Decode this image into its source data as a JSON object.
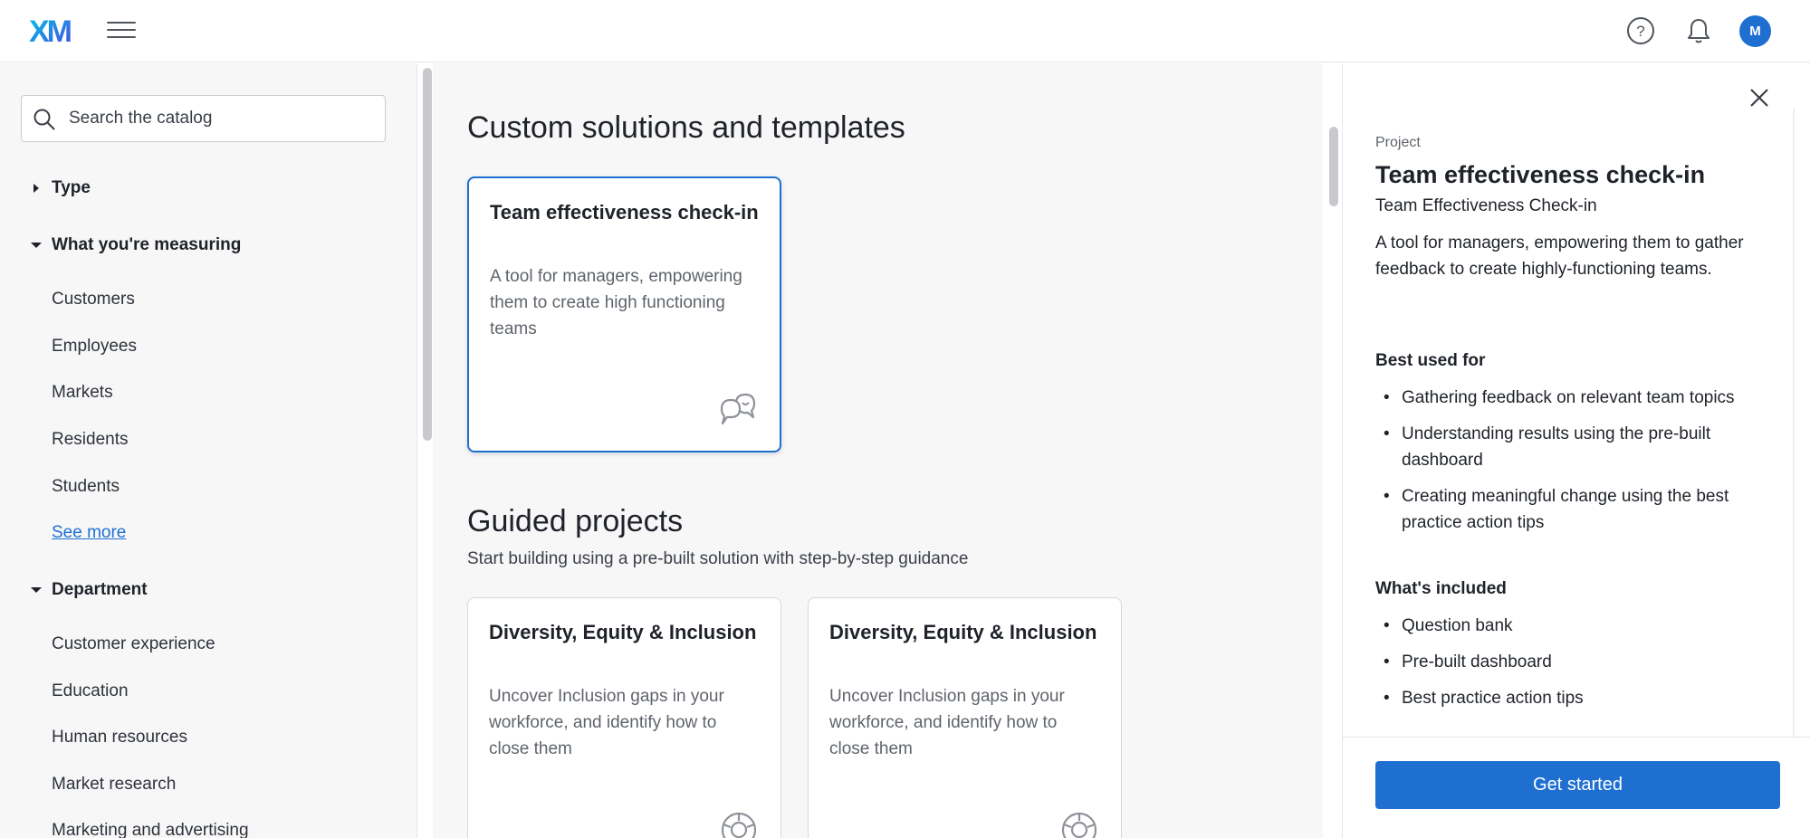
{
  "header": {
    "logo_text": "XM",
    "avatar_initial": "M"
  },
  "sidebar": {
    "search_placeholder": "Search the catalog",
    "facets": [
      {
        "label": "Type",
        "expanded": false
      },
      {
        "label": "What you're measuring",
        "expanded": true,
        "options": [
          "Customers",
          "Employees",
          "Markets",
          "Residents",
          "Students"
        ],
        "see_more": "See more"
      },
      {
        "label": "Department",
        "expanded": true,
        "options": [
          "Customer experience",
          "Education",
          "Human resources",
          "Market research",
          "Marketing and advertising"
        ]
      }
    ]
  },
  "main": {
    "custom_heading": "Custom solutions and templates",
    "custom_cards": [
      {
        "title": "Team effectiveness check-in",
        "description": "A tool for managers, empowering them to create high functioning teams",
        "icon": "chat-bubbles-icon"
      }
    ],
    "guided_heading": "Guided projects",
    "guided_subtitle": "Start building using a pre-built solution with step-by-step guidance",
    "guided_cards": [
      {
        "title": "Diversity, Equity & Inclusion",
        "description": "Uncover Inclusion gaps in your workforce, and identify how to close them",
        "icon": "segmented-circle-icon"
      },
      {
        "title": "Diversity, Equity & Inclusion",
        "description": "Uncover Inclusion gaps in your workforce, and identify how to close them",
        "icon": "segmented-circle-icon"
      }
    ]
  },
  "panel": {
    "kind": "Project",
    "title": "Team effectiveness check-in",
    "subtitle": "Team Effectiveness Check-in",
    "description": "A tool for managers, empowering them to gather feedback to create highly-functioning teams.",
    "best_used_heading": "Best used for",
    "best_used": [
      "Gathering feedback on relevant team topics",
      "Understanding results using the pre-built dashboard",
      "Creating meaningful change using the best practice action tips"
    ],
    "included_heading": "What's included",
    "included": [
      "Question bank",
      "Pre-built dashboard",
      "Best practice action tips"
    ],
    "cta": "Get started"
  },
  "colors": {
    "accent": "#1f6fd1",
    "logo_gradient_start": "#00c6e8",
    "logo_gradient_end": "#4a4ae0"
  }
}
